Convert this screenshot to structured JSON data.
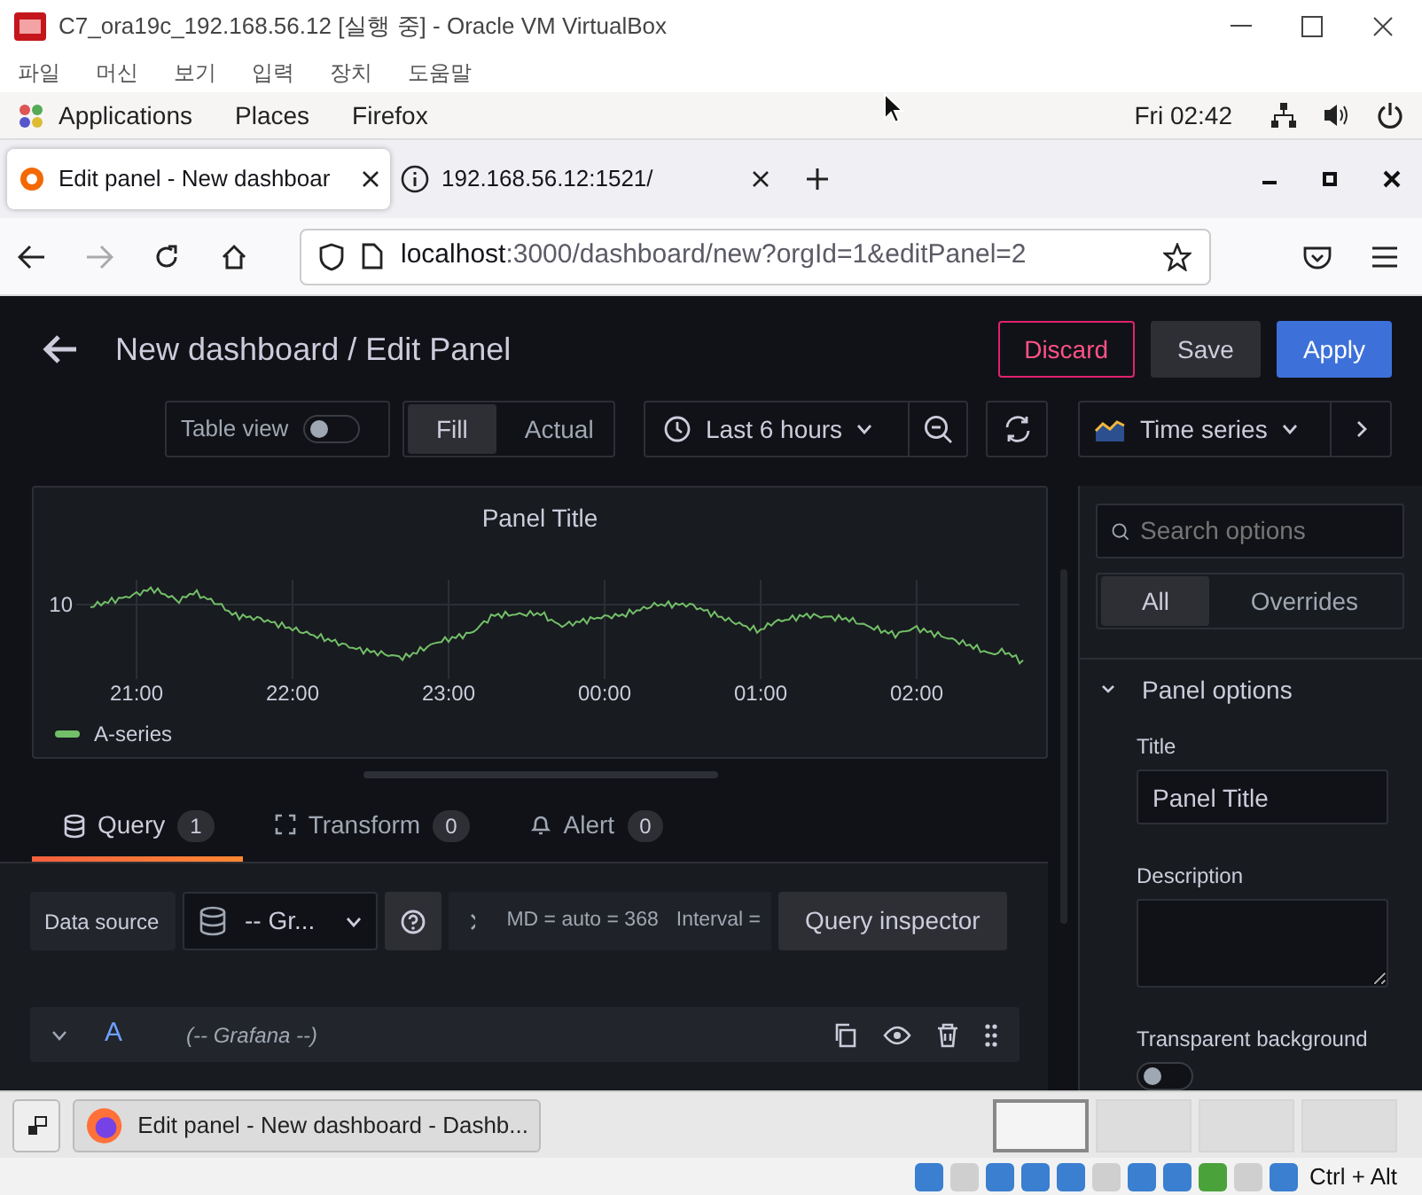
{
  "window": {
    "title": "C7_ora19c_192.168.56.12 [실행 중] - Oracle VM VirtualBox"
  },
  "menu": [
    "파일",
    "머신",
    "보기",
    "입력",
    "장치",
    "도움말"
  ],
  "top_bar": {
    "items": [
      "Applications",
      "Places",
      "Firefox"
    ],
    "clock": "Fri 02:42"
  },
  "browser": {
    "tabs": [
      {
        "title": "Edit panel - New dashboar",
        "selected": true
      },
      {
        "title": "192.168.56.12:1521/",
        "selected": false
      }
    ],
    "url": {
      "host": "localhost",
      "rest": ":3000/dashboard/new?orgId=1&editPanel=2"
    }
  },
  "grafana": {
    "header": {
      "title": "New dashboard / Edit Panel",
      "buttons": [
        {
          "label": "Discard",
          "kind": "danger"
        },
        {
          "label": "Save",
          "kind": "secondary"
        },
        {
          "label": "Apply",
          "kind": "primary"
        }
      ]
    },
    "toolbar": {
      "table_view": {
        "label": "Table view",
        "on": false
      },
      "modes": [
        {
          "label": "Fill",
          "selected": true
        },
        {
          "label": "Actual",
          "selected": false
        }
      ],
      "time_range": "Last 6 hours",
      "visualization": "Time series"
    },
    "panel": {
      "title": "Panel Title",
      "y_labels": [
        "10"
      ],
      "x_labels": [
        "21:00",
        "22:00",
        "23:00",
        "00:00",
        "01:00",
        "02:00"
      ],
      "legend": [
        {
          "name": "A-series",
          "color": "#73bf69"
        }
      ]
    },
    "editor_tabs": [
      {
        "label": "Query",
        "count": "1",
        "selected": true
      },
      {
        "label": "Transform",
        "count": "0",
        "selected": false
      },
      {
        "label": "Alert",
        "count": "0",
        "selected": false
      }
    ],
    "query_options": {
      "data_source_label": "Data source",
      "data_source": "-- Gr...",
      "md": "MD = auto = 368",
      "interval": "Interval =",
      "inspector": "Query inspector"
    },
    "queries": [
      {
        "ref": "A",
        "source": "(-- Grafana --)",
        "expanded": true
      }
    ],
    "options_pane": {
      "search_placeholder": "Search options",
      "tabs": [
        {
          "label": "All",
          "selected": true
        },
        {
          "label": "Overrides",
          "selected": false
        }
      ],
      "section": {
        "title": "Panel options",
        "expanded": true
      },
      "fields": [
        {
          "kind": "input",
          "label": "Title",
          "value": "Panel Title"
        },
        {
          "kind": "textarea",
          "label": "Description"
        },
        {
          "kind": "toggle",
          "label": "Transparent background",
          "on": false
        }
      ]
    }
  },
  "taskbar": {
    "tasks": [
      {
        "title": "Edit panel - New dashboard - Dashb..."
      }
    ],
    "workspaces": [
      {
        "selected": true
      },
      {
        "selected": false
      },
      {
        "selected": false
      },
      {
        "selected": false
      }
    ]
  },
  "status_bar": {
    "host_key": "Ctrl + Alt"
  }
}
